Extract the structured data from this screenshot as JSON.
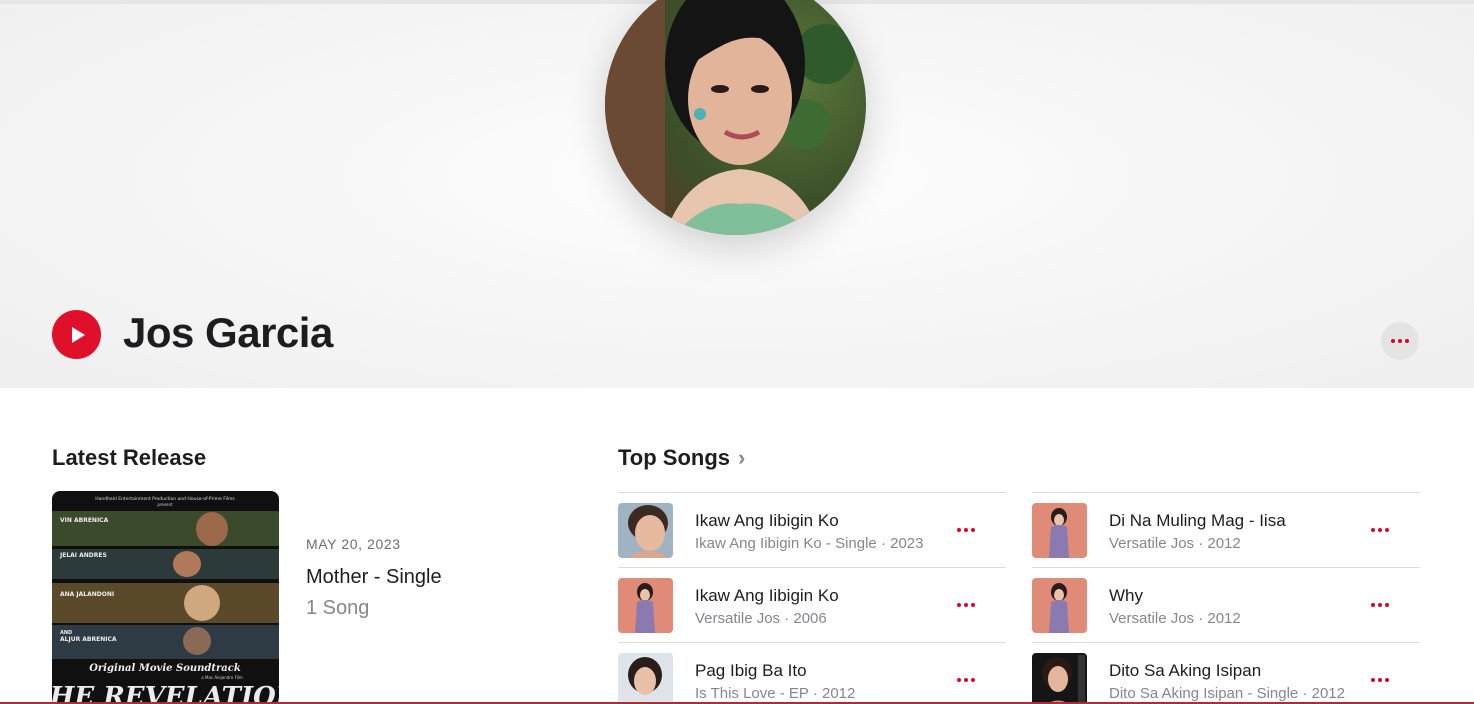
{
  "artist": {
    "name": "Jos Garcia",
    "photo_icon": "artist-portrait"
  },
  "colors": {
    "accent": "#e0102b",
    "more_dots": "#d10a2a",
    "hero_bg": "#f2f2f2",
    "text_primary": "#1d1d1f",
    "text_secondary": "#86868b"
  },
  "latest_release": {
    "section_title": "Latest Release",
    "date": "MAY 20, 2023",
    "name": "Mother - Single",
    "count": "1 Song",
    "art_text": {
      "header": "Handheld Entertainment Production and House-of-Prime Films",
      "header_sub": "present",
      "cast": [
        "VIN ABRENICA",
        "JELAI ANDRES",
        "ANA JALANDONI",
        "AND",
        "ALJUR ABRENICA"
      ],
      "soundtrack": "Original Movie Soundtrack",
      "film_title": "THE REVELATION",
      "credit": "a Mac Alejandre Film"
    }
  },
  "top_songs": {
    "section_title": "Top Songs",
    "left": [
      {
        "title": "Ikaw Ang Iibigin Ko",
        "subtitle": "Ikaw Ang Iibigin Ko - Single · 2023",
        "thumb": "portrait-closeup"
      },
      {
        "title": "Ikaw Ang Iibigin Ko",
        "subtitle": "Versatile Jos · 2006",
        "thumb": "portrait-pink"
      },
      {
        "title": "Pag Ibig Ba Ito",
        "subtitle": "Is This Love - EP · 2012",
        "thumb": "portrait-light"
      }
    ],
    "right": [
      {
        "title": "Di Na Muling Mag - Iisa",
        "subtitle": "Versatile Jos · 2012",
        "thumb": "portrait-pink"
      },
      {
        "title": "Why",
        "subtitle": "Versatile Jos · 2012",
        "thumb": "portrait-pink"
      },
      {
        "title": "Dito Sa Aking Isipan",
        "subtitle": "Dito Sa Aking Isipan - Single · 2012",
        "thumb": "portrait-dark"
      }
    ]
  }
}
